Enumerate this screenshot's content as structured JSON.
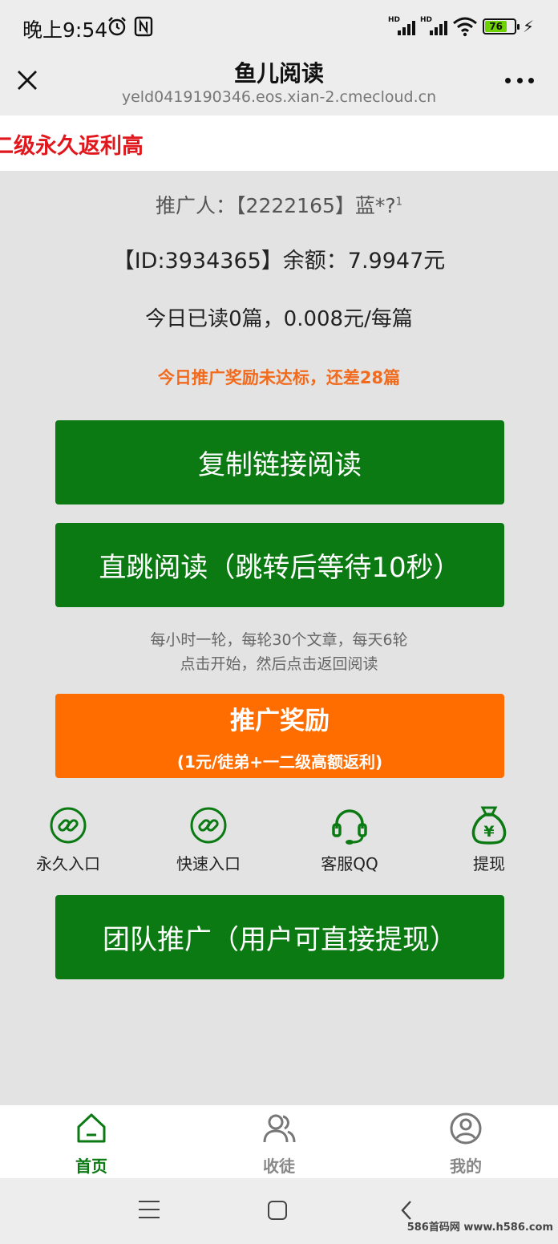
{
  "status_bar": {
    "time": "晚上9:54",
    "signal1_label": "HD",
    "signal2_label": "HD",
    "battery": "76",
    "icons": [
      "alarm-icon",
      "nfc-icon",
      "signal-icon",
      "wifi-icon",
      "battery-icon",
      "charging-icon"
    ]
  },
  "nav": {
    "title": "鱼儿阅读",
    "url": "yeld0419190346.eos.xian-2.cmecloud.cn",
    "icons": [
      "close-icon",
      "more-icon"
    ]
  },
  "banner": {
    "text": "二级永久返利高"
  },
  "main": {
    "promoter": "推广人：【2222165】蓝*?",
    "promoter_sup": "1",
    "balance": "【ID:3934365】余额：7.9947元",
    "today": "今日已读0篇，0.008元/每篇",
    "warning": "今日推广奖励未达标，还差28篇",
    "copy_button": "复制链接阅读",
    "jump_button": "直跳阅读（跳转后等待10秒）",
    "hint_line1": "每小时一轮，每轮30个文章，每天6轮",
    "hint_line2": "点击开始，然后点击返回阅读",
    "reward_title": "推广奖励",
    "reward_subtitle": "(1元/徒弟+一二级高额返利)",
    "quick_links": [
      {
        "label": "永久入口",
        "icon": "link-icon"
      },
      {
        "label": "快速入口",
        "icon": "link-icon"
      },
      {
        "label": "客服QQ",
        "icon": "headset-icon"
      },
      {
        "label": "提现",
        "icon": "money-bag-icon"
      }
    ],
    "team_button": "团队推广（用户可直接提现）"
  },
  "tabbar": {
    "tabs": [
      {
        "label": "首页",
        "icon": "home-icon",
        "active": true
      },
      {
        "label": "收徒",
        "icon": "users-icon",
        "active": false
      },
      {
        "label": "我的",
        "icon": "user-icon",
        "active": false
      }
    ]
  },
  "system_nav": {
    "watermark": "586首码网 www.h586.com",
    "icons": [
      "menu-icon",
      "home-square-icon",
      "back-icon"
    ]
  },
  "colors": {
    "green": "#0b7a13",
    "orange": "#ff6d00",
    "warning": "#f26b1d",
    "banner_red": "#e0171c"
  }
}
